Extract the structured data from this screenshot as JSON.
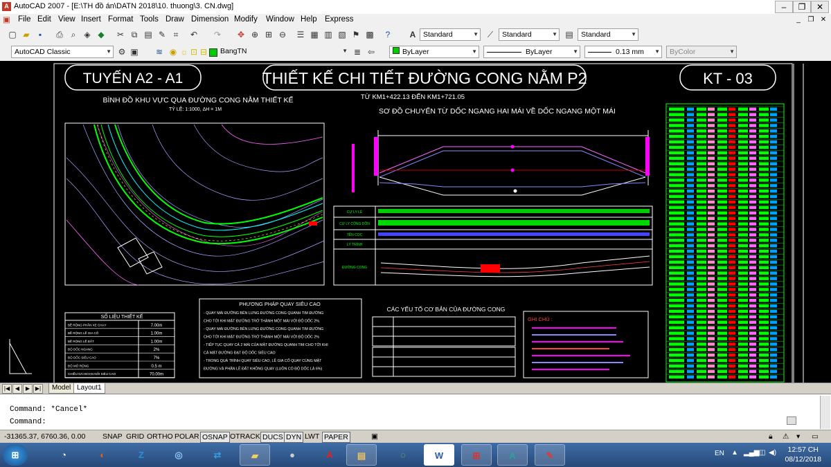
{
  "window": {
    "title": "AutoCAD 2007 - [E:\\TH đồ án\\DATN 2018\\10. thuong\\3. CN.dwg]"
  },
  "menu": [
    "File",
    "Edit",
    "View",
    "Insert",
    "Format",
    "Tools",
    "Draw",
    "Dimension",
    "Modify",
    "Window",
    "Help",
    "Express"
  ],
  "toolbar": {
    "text_style": "Standard",
    "dim_style": "Standard",
    "table_style": "Standard",
    "workspace": "AutoCAD Classic",
    "layer": "BangTN",
    "color": "ByLayer",
    "linetype": "ByLayer",
    "lineweight": "0.13 mm",
    "plotstyle": "ByColor"
  },
  "drawing": {
    "title_left": "TUYẾN A2 - A1",
    "title_main": "THIẾT KẾ CHI TIẾT ĐƯỜNG CONG NẰM P2",
    "title_code": "KT - 03",
    "subtitle_range": "TỪ KM1+422.13 ĐẾN KM1+721.05",
    "plan_title": "BÌNH ĐỒ KHU VỰC QUA ĐƯỜNG CONG NẰM THIẾT KẾ",
    "plan_scale": "TỶ LỆ: 1:1000, ΔH = 1M",
    "diagram_title": "SƠ ĐỒ CHUYỂN TỪ DỐC NGANG HAI MÁI VỀ DỐC NGANG MỘT MÁI",
    "profile_rows": [
      "CỰ LY LẺ",
      "CỰ LY CỘNG DỒN",
      "TÊN CỌC",
      "LÝ TRÌNH",
      "ĐƯỜNG CONG"
    ],
    "design_table_title": "SỐ LIỆU THIẾT KẾ",
    "design_rows": [
      {
        "label": "BỀ RỘNG PHẦN XE CHẠY",
        "value": "7.00m"
      },
      {
        "label": "BỀ RỘNG LỀ GIA CỐ",
        "value": "1.00m"
      },
      {
        "label": "BỀ RỘNG LỀ ĐẤT",
        "value": "1.00m"
      },
      {
        "label": "ĐỘ DỐC NGANG",
        "value": "2%"
      },
      {
        "label": "ĐỘ DỐC SIÊU CAO",
        "value": "7%"
      },
      {
        "label": "ĐỘ MỞ RỘNG",
        "value": "0.5 m"
      },
      {
        "label": "CHIỀU DÀI ĐOẠN NỐI SIÊU CAO",
        "value": "70.00m"
      }
    ],
    "method_title": "PHƯƠNG PHÁP QUAY SIÊU CAO",
    "method_lines": [
      "- QUAY MÁI ĐƯỜNG BÊN LƯNG ĐƯỜNG CONG QUANH TIM ĐƯỜNG",
      "CHO TỚI KHI MẶT ĐƯỜNG TRỞ THÀNH MỘT MÁI VỚI ĐỘ DỐC 2%.",
      "- QUAY MÁI ĐƯỜNG BÊN LƯNG ĐƯỜNG CONG QUANH TIM ĐƯỜNG",
      "CHO TỚI KHI MẶT ĐƯỜNG TRỞ THÀNH MỘT MÁI VỚI ĐỘ DỐC 2%",
      "- TIẾP TỤC QUAY CẢ 2 MÁI CỦA MẶT ĐƯỜNG QUANH TIM CHO TỚI KHI",
      "CẢ MẶT ĐƯỜNG ĐẠT ĐỘ DỐC SIÊU CAO",
      "- TRONG QUÁ TRÌNH QUAY SIÊU CAO, LỀ GIA CỐ QUAY CÙNG MẶT",
      "ĐƯỜNG VÀ PHẦN LỀ ĐẤT KHÔNG QUAY (LUÔN CÓ ĐỘ DỐC LÀ 6%)"
    ],
    "curve_table_title": "CÁC YẾU TỐ CƠ BẢN CỦA ĐƯỜNG CONG",
    "notes_title": "GHI CHÚ :"
  },
  "layout_tabs": [
    "Model",
    "Layout1"
  ],
  "command": {
    "history": "Command: *Cancel*",
    "prompt": "Command:"
  },
  "status": {
    "coords": "-31365.37, 6760.36, 0.00",
    "toggles": [
      "SNAP",
      "GRID",
      "ORTHO",
      "POLAR",
      "OSNAP",
      "OTRACK",
      "DUCS",
      "DYN",
      "LWT",
      "PAPER"
    ]
  },
  "taskbar": {
    "lang": "EN",
    "time": "12:57 CH",
    "date": "08/12/2018"
  },
  "colors": {
    "accent_green": "#00ff00",
    "accent_magenta": "#ff00ff",
    "accent_red": "#ff0000"
  }
}
